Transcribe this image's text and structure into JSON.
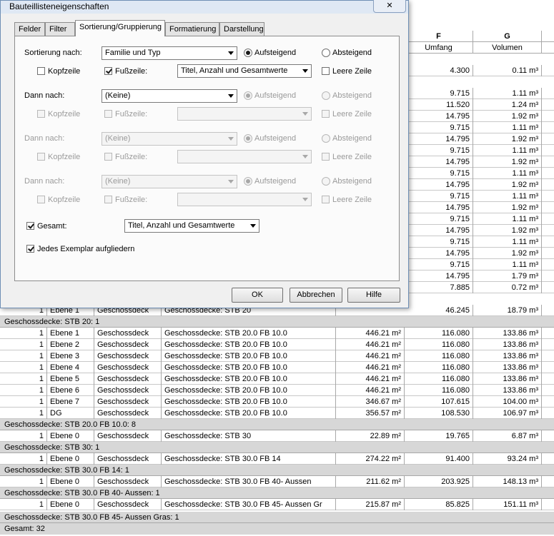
{
  "dialog": {
    "title": "Bauteillisteneigenschaften",
    "close_label": "✕",
    "tabs": [
      {
        "label": "Felder"
      },
      {
        "label": "Filter"
      },
      {
        "label": "Sortierung/Gruppierung"
      },
      {
        "label": "Formatierung"
      },
      {
        "label": "Darstellung"
      }
    ],
    "active_tab": "Sortierung/Gruppierung",
    "sort_label": "Sortierung nach:",
    "sort_value": "Familie und Typ",
    "then_label": "Dann nach:",
    "none_value": "(Keine)",
    "ascending": "Aufsteigend",
    "descending": "Absteigend",
    "header_label": "Kopfzeile",
    "footer_label": "Fußzeile:",
    "footer_value": "Titel, Anzahl und Gesamtwerte",
    "blank_line_label": "Leere Zeile",
    "total_label": "Gesamt:",
    "total_value": "Titel, Anzahl und Gesamtwerte",
    "itemize_label": "Jedes Exemplar aufgliedern",
    "ok_label": "OK",
    "cancel_label": "Abbrechen",
    "help_label": "Hilfe"
  },
  "schedule": {
    "header_letters": {
      "F": "F",
      "G": "G"
    },
    "col_headers": {
      "umfang": "Umfang",
      "volumen": "Volumen"
    },
    "top_values": [
      {
        "f": "4.300",
        "g": "0.11 m³"
      },
      {
        "f": "9.715",
        "g": "1.11 m³"
      },
      {
        "f": "11.520",
        "g": "1.24 m³"
      },
      {
        "f": "14.795",
        "g": "1.92 m³"
      },
      {
        "f": "9.715",
        "g": "1.11 m³"
      },
      {
        "f": "14.795",
        "g": "1.92 m³"
      },
      {
        "f": "9.715",
        "g": "1.11 m³"
      },
      {
        "f": "14.795",
        "g": "1.92 m³"
      },
      {
        "f": "9.715",
        "g": "1.11 m³"
      },
      {
        "f": "14.795",
        "g": "1.92 m³"
      },
      {
        "f": "9.715",
        "g": "1.11 m³"
      },
      {
        "f": "14.795",
        "g": "1.92 m³"
      },
      {
        "f": "9.715",
        "g": "1.11 m³"
      },
      {
        "f": "14.795",
        "g": "1.92 m³"
      },
      {
        "f": "9.715",
        "g": "1.11 m³"
      },
      {
        "f": "14.795",
        "g": "1.92 m³"
      },
      {
        "f": "9.715",
        "g": "1.11 m³"
      },
      {
        "f": "14.795",
        "g": "1.79 m³"
      },
      {
        "f": "7.885",
        "g": "0.72 m³"
      }
    ],
    "partial_row": {
      "c1": "1",
      "c2": "Ebene 1",
      "c3": "Geschossdeck",
      "c4": "Geschossdecke: STB 20",
      "c5": "",
      "f": "46.245",
      "g": "18.79 m³"
    },
    "groups": [
      {
        "label": "Geschossdecke: STB 20: 1",
        "rows": [
          {
            "n": "1",
            "level": "Ebene 1",
            "family": "Geschossdeck",
            "type": "Geschossdecke: STB 20.0  FB 10.0",
            "area": "446.21 m²",
            "f": "116.080",
            "g": "133.86 m³"
          },
          {
            "n": "1",
            "level": "Ebene 2",
            "family": "Geschossdeck",
            "type": "Geschossdecke: STB 20.0  FB 10.0",
            "area": "446.21 m²",
            "f": "116.080",
            "g": "133.86 m³"
          },
          {
            "n": "1",
            "level": "Ebene 3",
            "family": "Geschossdeck",
            "type": "Geschossdecke: STB 20.0  FB 10.0",
            "area": "446.21 m²",
            "f": "116.080",
            "g": "133.86 m³"
          },
          {
            "n": "1",
            "level": "Ebene 4",
            "family": "Geschossdeck",
            "type": "Geschossdecke: STB 20.0  FB 10.0",
            "area": "446.21 m²",
            "f": "116.080",
            "g": "133.86 m³"
          },
          {
            "n": "1",
            "level": "Ebene 5",
            "family": "Geschossdeck",
            "type": "Geschossdecke: STB 20.0  FB 10.0",
            "area": "446.21 m²",
            "f": "116.080",
            "g": "133.86 m³"
          },
          {
            "n": "1",
            "level": "Ebene 6",
            "family": "Geschossdeck",
            "type": "Geschossdecke: STB 20.0  FB 10.0",
            "area": "446.21 m²",
            "f": "116.080",
            "g": "133.86 m³"
          },
          {
            "n": "1",
            "level": "Ebene 7",
            "family": "Geschossdeck",
            "type": "Geschossdecke: STB 20.0  FB 10.0",
            "area": "346.67 m²",
            "f": "107.615",
            "g": "104.00 m³"
          },
          {
            "n": "1",
            "level": "DG",
            "family": "Geschossdeck",
            "type": "Geschossdecke: STB 20.0  FB 10.0",
            "area": "356.57 m²",
            "f": "108.530",
            "g": "106.97 m³"
          }
        ]
      },
      {
        "label": "Geschossdecke: STB 20.0  FB 10.0: 8",
        "rows": [
          {
            "n": "1",
            "level": "Ebene 0",
            "family": "Geschossdeck",
            "type": "Geschossdecke: STB 30",
            "area": "22.89 m²",
            "f": "19.765",
            "g": "6.87 m³"
          }
        ]
      },
      {
        "label": "Geschossdecke: STB 30: 1",
        "rows": [
          {
            "n": "1",
            "level": "Ebene 0",
            "family": "Geschossdeck",
            "type": "Geschossdecke: STB 30.0  FB 14",
            "area": "274.22 m²",
            "f": "91.400",
            "g": "93.24 m³"
          }
        ]
      },
      {
        "label": "Geschossdecke: STB 30.0  FB 14: 1",
        "rows": [
          {
            "n": "1",
            "level": "Ebene 0",
            "family": "Geschossdeck",
            "type": "Geschossdecke: STB 30.0  FB 40- Aussen",
            "area": "211.62 m²",
            "f": "203.925",
            "g": "148.13 m³"
          }
        ]
      },
      {
        "label": "Geschossdecke: STB 30.0  FB 40- Aussen: 1",
        "rows": [
          {
            "n": "1",
            "level": "Ebene 0",
            "family": "Geschossdeck",
            "type": "Geschossdecke: STB 30.0  FB 45- Aussen Gr",
            "area": "215.87 m²",
            "f": "85.825",
            "g": "151.11 m³"
          }
        ]
      }
    ],
    "last_group_label": "Geschossdecke: STB 30.0  FB 45- Aussen Gras: 1",
    "grand_total": "Gesamt: 32"
  }
}
